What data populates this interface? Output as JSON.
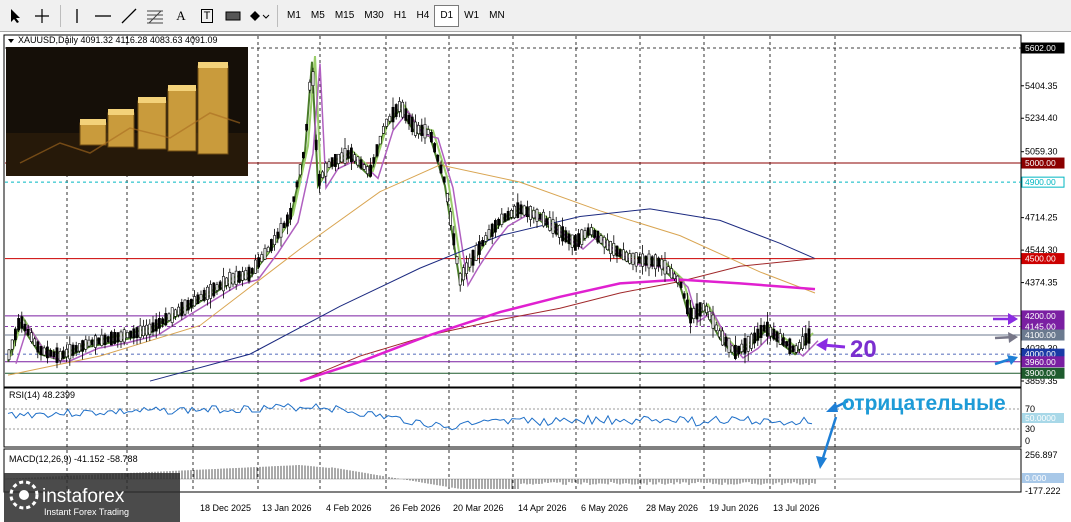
{
  "toolbar": {
    "timeframes": [
      "M1",
      "M5",
      "M15",
      "M30",
      "H1",
      "H4",
      "D1",
      "W1",
      "MN"
    ],
    "active_timeframe": "D1",
    "tools": [
      "cursor-icon",
      "crosshair-icon",
      "vertical-line-icon",
      "horizontal-line-icon",
      "trendline-icon",
      "fibonacci-icon",
      "text-icon",
      "label-icon",
      "rectangle-icon",
      "shapes-dropdown-icon"
    ],
    "text_tool": "A",
    "label_tool": "T"
  },
  "chart": {
    "header": "XAUUSD,Daily  4091.32 4116.28 4083.63 4091.09",
    "price_ticks": [
      "5404.35",
      "5234.40",
      "5059.30",
      "4714.25",
      "4544.30",
      "4374.35",
      "4029.30",
      "3859.35"
    ],
    "date_ticks": [
      "18 Dec 2025",
      "13 Jan 2026",
      "4 Feb 2026",
      "26 Feb 2026",
      "20 Mar 2026",
      "14 Apr 2026",
      "6 May 2026",
      "28 May 2026",
      "19 Jun 2026",
      "13 Jul 2026"
    ],
    "level_labels": [
      {
        "text": "5602.00",
        "bg": "#000000"
      },
      {
        "text": "5000.00",
        "bg": "#8b0000"
      },
      {
        "text": "4900.00",
        "bg": "#ffffff"
      },
      {
        "text": "4500.00",
        "bg": "#cc0000"
      },
      {
        "text": "4200.00",
        "bg": "#7a1fa2"
      },
      {
        "text": "4145.00",
        "bg": "#7a1fa2"
      },
      {
        "text": "4100.00",
        "bg": "#6b7a8f"
      },
      {
        "text": "4000.00",
        "bg": "#1a3aa6"
      },
      {
        "text": "3960.00",
        "bg": "#7a1fa2"
      },
      {
        "text": "3900.00",
        "bg": "#1f5c2e"
      }
    ],
    "annotation_number": "20",
    "annotation_word": "отрицательные",
    "colors": {
      "level_5000": "#8b0000",
      "level_4500": "#cc0000",
      "level_4900": "#00b7c2",
      "level_4200": "#7a1fa2",
      "arrow_purple": "#8a2be2",
      "arrow_blue": "#1e7fd6",
      "annotation_text": "#1e9bd7"
    }
  },
  "rsi": {
    "label": "RSI(14) 48.2399",
    "ticks": [
      "70",
      "30",
      "0"
    ],
    "level_label": "50.0000"
  },
  "macd": {
    "label": "MACD(12,26,9) -41.152 -58.788",
    "ticks": [
      "256.897",
      "-177.222"
    ],
    "zero_label": "0.000"
  },
  "logo": {
    "brand": "instaforex",
    "tagline": "Instant Forex Trading"
  }
}
